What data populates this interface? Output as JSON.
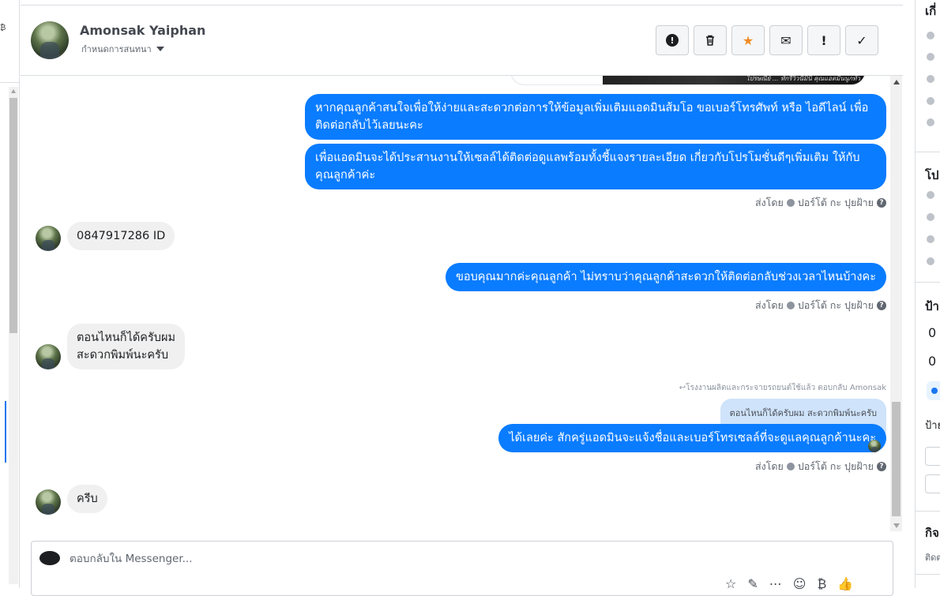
{
  "header": {
    "contact_name": "Amonsak Yaiphan",
    "label_dropdown": "กำหนดการสนทนา"
  },
  "actions": [
    {
      "name": "spam-button",
      "icon": "alert-circle-icon"
    },
    {
      "name": "delete-button",
      "icon": "trash-icon"
    },
    {
      "name": "star-button",
      "icon": "star-icon",
      "color": "#f08a24"
    },
    {
      "name": "mark-unread-button",
      "icon": "envelope-icon"
    },
    {
      "name": "follow-up-button",
      "icon": "exclamation-icon"
    },
    {
      "name": "mark-done-button",
      "icon": "check-icon"
    }
  ],
  "chat": {
    "image_caption": "ไปรษณีย์ ... ทักรีวิวนี้มินิ คุณแอดมินนูกทั่ว",
    "out_msg_1": "หากคุณลูกค้าสนใจเพื่อให้ง่ายและสะดวกต่อการให้ข้อมูลเพิ่มเติมแอดมินส้มโอ ขอเบอร์โทรศัพท์ หรือ ไอดีไลน์ เพื่อติดต่อกลับไว้เลยนะคะ",
    "out_msg_2": "เพื่อแอดมินจะได้ประสานงานให้เซลล์ได้ติดต่อดูแลพร้อมทั้งชี้แจงรายละเอียด เกี่ยวกับโปรโมชั่นดีๆเพิ่มเติม ให้กับคุณลูกค้าค่ะ",
    "sent_by": "ส่งโดย",
    "sender": "ปอร์โต้ กะ ปุยฝ้าย",
    "in_msg_1": "0847917286 ID",
    "out_msg_3": "ขอบคุณมากค่ะคุณลูกค้า ไม่ทราบว่าคุณลูกค้าสะดวกให้ติดต่อกลับช่วงเวลาไหนบ้างคะ",
    "in_msg_2_line1": "ตอนไหนก็ได้ครับผม",
    "in_msg_2_line2": "สะดวกพิมพ์นะครับ",
    "reply_note": "↩โรงงานผลิตและกระจายรถยนต์ใช้แล้ว ตอบกลับ Amonsak",
    "quoted_text": "ตอนไหนก็ได้ครับผม สะดวกพิมพ์นะครับ",
    "out_msg_4": "ได้เลยค่ะ สักครู่แอดมินจะแจ้งชื่อและเบอร์โทรเซลล์ที่จะดูแลคุณลูกค้านะคะ",
    "in_msg_3": "ครีบ"
  },
  "composer": {
    "placeholder": "ตอบกลับใน Messenger..."
  },
  "right_panel": {
    "section_1_title": "เกี่",
    "section_2_title": "โป",
    "section_3_title": "ป้า",
    "tag_label": "ป้าย",
    "section_4_title": "กิจ",
    "section_4_sub": "ติดต"
  },
  "colors": {
    "outgoing_bubble": "#0a7cff",
    "incoming_bubble": "#f0f0f0",
    "quoted_bubble": "#cfe3fb"
  }
}
